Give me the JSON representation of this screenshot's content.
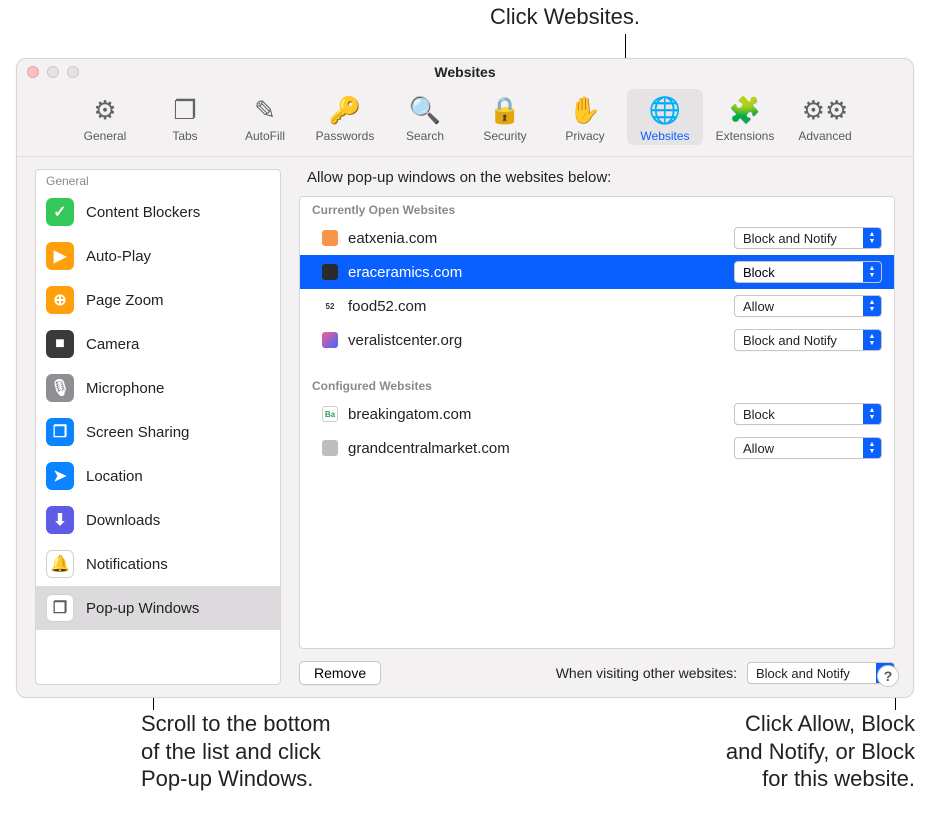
{
  "callouts": {
    "top": "Click Websites.",
    "bottom_left": "Scroll to the bottom\nof the list and click\nPop-up Windows.",
    "bottom_right": "Click Allow, Block\nand Notify, or Block\nfor this website."
  },
  "window": {
    "title": "Websites"
  },
  "toolbar": {
    "items": [
      {
        "label": "General",
        "glyph": "⚙",
        "name": "general"
      },
      {
        "label": "Tabs",
        "glyph": "❐",
        "name": "tabs"
      },
      {
        "label": "AutoFill",
        "glyph": "✎",
        "name": "autofill"
      },
      {
        "label": "Passwords",
        "glyph": "🔑",
        "name": "passwords"
      },
      {
        "label": "Search",
        "glyph": "🔍",
        "name": "search"
      },
      {
        "label": "Security",
        "glyph": "🔒",
        "name": "security"
      },
      {
        "label": "Privacy",
        "glyph": "✋",
        "name": "privacy"
      },
      {
        "label": "Websites",
        "glyph": "🌐",
        "name": "websites",
        "selected": true
      },
      {
        "label": "Extensions",
        "glyph": "🧩",
        "name": "extensions"
      },
      {
        "label": "Advanced",
        "glyph": "⚙⚙",
        "name": "advanced"
      }
    ]
  },
  "sidebar": {
    "header": "General",
    "items": [
      {
        "label": "Content Blockers",
        "name": "content-blockers",
        "color": "#34c759",
        "glyph": "✓"
      },
      {
        "label": "Auto-Play",
        "name": "auto-play",
        "color": "#ff9f0a",
        "glyph": "▶"
      },
      {
        "label": "Page Zoom",
        "name": "page-zoom",
        "color": "#ff9f0a",
        "glyph": "⊕"
      },
      {
        "label": "Camera",
        "name": "camera",
        "color": "#3a3a3c",
        "glyph": "■"
      },
      {
        "label": "Microphone",
        "name": "microphone",
        "color": "#8e8e93",
        "glyph": "🎙"
      },
      {
        "label": "Screen Sharing",
        "name": "screen-sharing",
        "color": "#0a84ff",
        "glyph": "❐"
      },
      {
        "label": "Location",
        "name": "location",
        "color": "#0a84ff",
        "glyph": "➤"
      },
      {
        "label": "Downloads",
        "name": "downloads",
        "color": "#5e5ce6",
        "glyph": "⬇"
      },
      {
        "label": "Notifications",
        "name": "notifications",
        "color": "#ffffff",
        "glyph": "🔔",
        "fg": "#ff3b30",
        "border": true
      },
      {
        "label": "Pop-up Windows",
        "name": "popup-windows",
        "color": "#ffffff",
        "glyph": "❐",
        "fg": "#5a5a5a",
        "border": true,
        "selected": true
      }
    ]
  },
  "main": {
    "title": "Allow pop-up windows on the websites below:",
    "groups": [
      {
        "header": "Currently Open Websites",
        "rows": [
          {
            "site": "eatxenia.com",
            "value": "Block and Notify",
            "favcolor": "#f99548"
          },
          {
            "site": "eraceramics.com",
            "value": "Block",
            "favcolor": "#2b2b2b",
            "selected": true
          },
          {
            "site": "food52.com",
            "value": "Allow",
            "favcolor": "#ffffff",
            "favtext": "52",
            "favtextcolor": "#333"
          },
          {
            "site": "veralistcenter.org",
            "value": "Block and Notify",
            "favgrad": true
          }
        ]
      },
      {
        "header": "Configured Websites",
        "rows": [
          {
            "site": "breakingatom.com",
            "value": "Block",
            "favcolor": "#ffffff",
            "favtext": "Ba",
            "favtextcolor": "#2e9e5b",
            "favborder": true
          },
          {
            "site": "grandcentralmarket.com",
            "value": "Allow",
            "favcolor": "#bdbdbd"
          }
        ]
      }
    ],
    "remove_label": "Remove",
    "footer_label": "When visiting other websites:",
    "footer_value": "Block and Notify"
  },
  "help": "?"
}
